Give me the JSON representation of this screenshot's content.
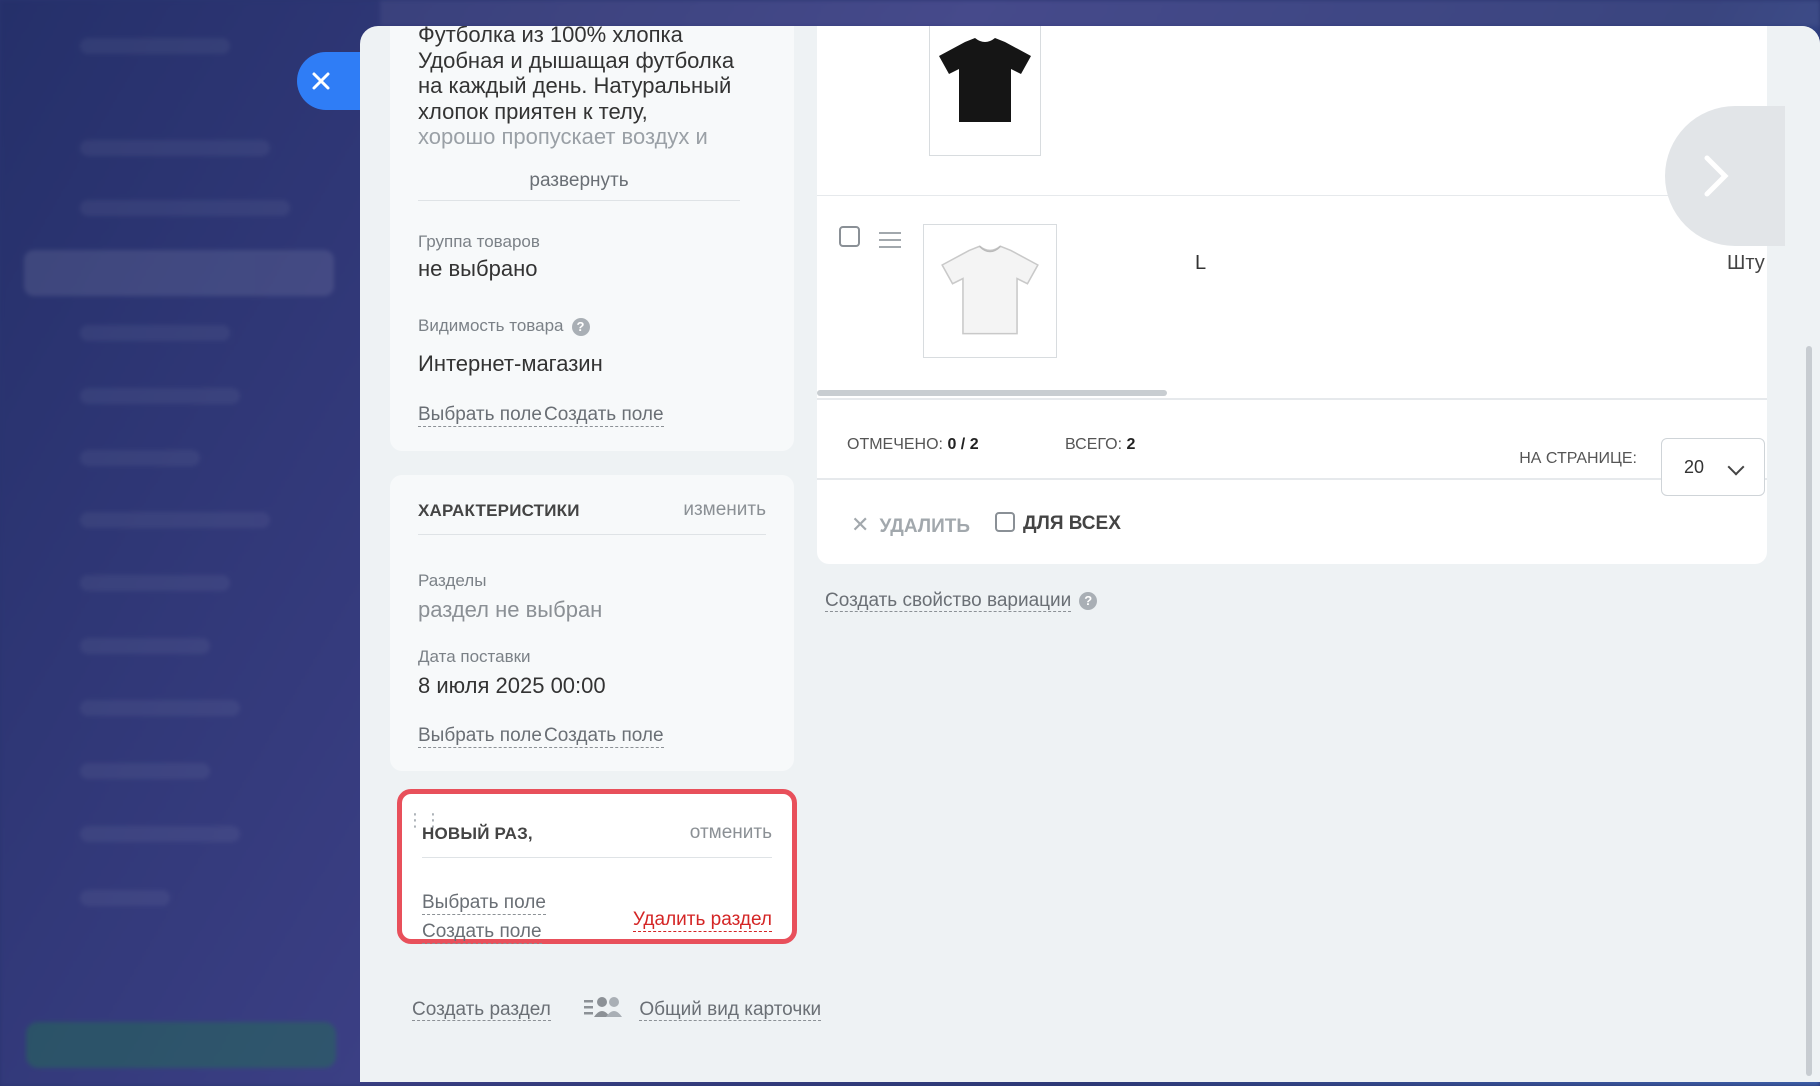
{
  "card_description": {
    "lines": [
      "Футболка из 100% хлопка",
      "Удобная и дышащая футболка",
      "на каждый день. Натуральный",
      "хлопок приятен к телу,",
      "хорошо пропускает воздух и"
    ],
    "expand_label": "развернуть"
  },
  "product_group": {
    "label": "Группа товаров",
    "value": "не выбрано"
  },
  "visibility": {
    "label": "Видимость товара",
    "value": "Интернет-магазин",
    "help_icon": "question-circle-icon"
  },
  "card_links": {
    "choose_field": "Выбрать поле",
    "create_field": "Создать поле"
  },
  "characteristics": {
    "title": "ХАРАКТЕРИСТИКИ",
    "action": "изменить",
    "sections_label": "Разделы",
    "sections_value": "раздел не выбран",
    "delivery_label": "Дата поставки",
    "delivery_value": "8 июля 2025 00:00"
  },
  "new_section": {
    "title": "НОВЫЙ РАЗ,",
    "cancel": "отменить",
    "delete": "Удалить раздел",
    "highlight_color": "#e8505b"
  },
  "bottom_links": {
    "create_section": "Создать раздел",
    "card_view": "Общий вид карточки"
  },
  "variations": {
    "rows": [
      {
        "image": "black-tshirt",
        "size": ""
      },
      {
        "image": "white-tshirt",
        "size": "L",
        "unit": "Шту"
      }
    ],
    "selected_label": "ОТМЕЧЕНО:",
    "selected_value": "0 / 2",
    "total_label": "ВСЕГО:",
    "total_value": "2",
    "per_page_label": "НА СТРАНИЦЕ:",
    "per_page_value": "20",
    "delete_label": "УДАЛИТЬ",
    "for_all_label": "ДЛЯ ВСЕХ",
    "create_property": "Создать свойство вариации"
  },
  "colors": {
    "accent": "#2f7df6",
    "danger": "#d42525",
    "panel_bg": "#eef2f4"
  }
}
